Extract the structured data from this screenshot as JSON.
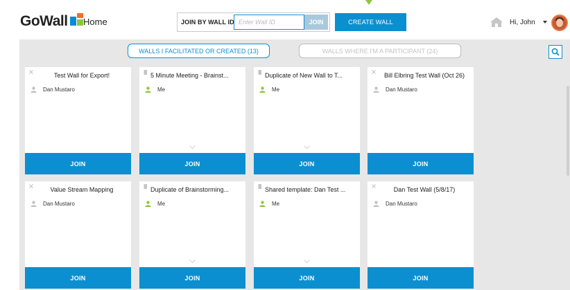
{
  "header": {
    "logo_text": "GoWall",
    "page_title": "Home",
    "join_label": "JOIN BY WALL ID",
    "join_placeholder": "Enter Wall ID",
    "join_value": "",
    "join_button": "JOIN",
    "create_button": "CREATE WALL",
    "greeting": "Hi, John",
    "colors": {
      "accent": "#0c8fd0",
      "join_disabled": "#a9c8dc",
      "drop_marker": "#8cc63f"
    }
  },
  "tabs": [
    {
      "label": "WALLS I FACILITATED OR CREATED (13)",
      "active": true
    },
    {
      "label": "WALLS WHERE I'M A PARTICIPANT (24)",
      "active": false
    }
  ],
  "cards": [
    {
      "title": "Test Wall for Export!",
      "owner": "Dan Mustaro",
      "icon": "close-icon",
      "owner_is_me": false,
      "join": "JOIN"
    },
    {
      "title": "5 Minute Meeting - Brainst...",
      "owner": "Me",
      "icon": "note-icon",
      "owner_is_me": true,
      "join": "JOIN"
    },
    {
      "title": "Duplicate of New Wall to T...",
      "owner": "Me",
      "icon": "note-icon",
      "owner_is_me": true,
      "join": "JOIN"
    },
    {
      "title": "Bill Elbring Test Wall (Oct 26)",
      "owner": "Dan Mustaro",
      "icon": "close-icon",
      "owner_is_me": false,
      "join": "JOIN"
    },
    {
      "title": "Value Stream Mapping",
      "owner": "Dan Mustaro",
      "icon": "close-icon",
      "owner_is_me": false,
      "join": "JOIN"
    },
    {
      "title": "Duplicate of Brainstorming...",
      "owner": "Me",
      "icon": "note-icon",
      "owner_is_me": true,
      "join": "JOIN"
    },
    {
      "title": "Shared template: Dan Test ...",
      "owner": "Me",
      "icon": "note-icon",
      "owner_is_me": true,
      "join": "JOIN"
    },
    {
      "title": "Dan Test Wall (5/8/17)",
      "owner": "Dan Mustaro",
      "icon": "close-icon",
      "owner_is_me": false,
      "join": "JOIN"
    }
  ]
}
